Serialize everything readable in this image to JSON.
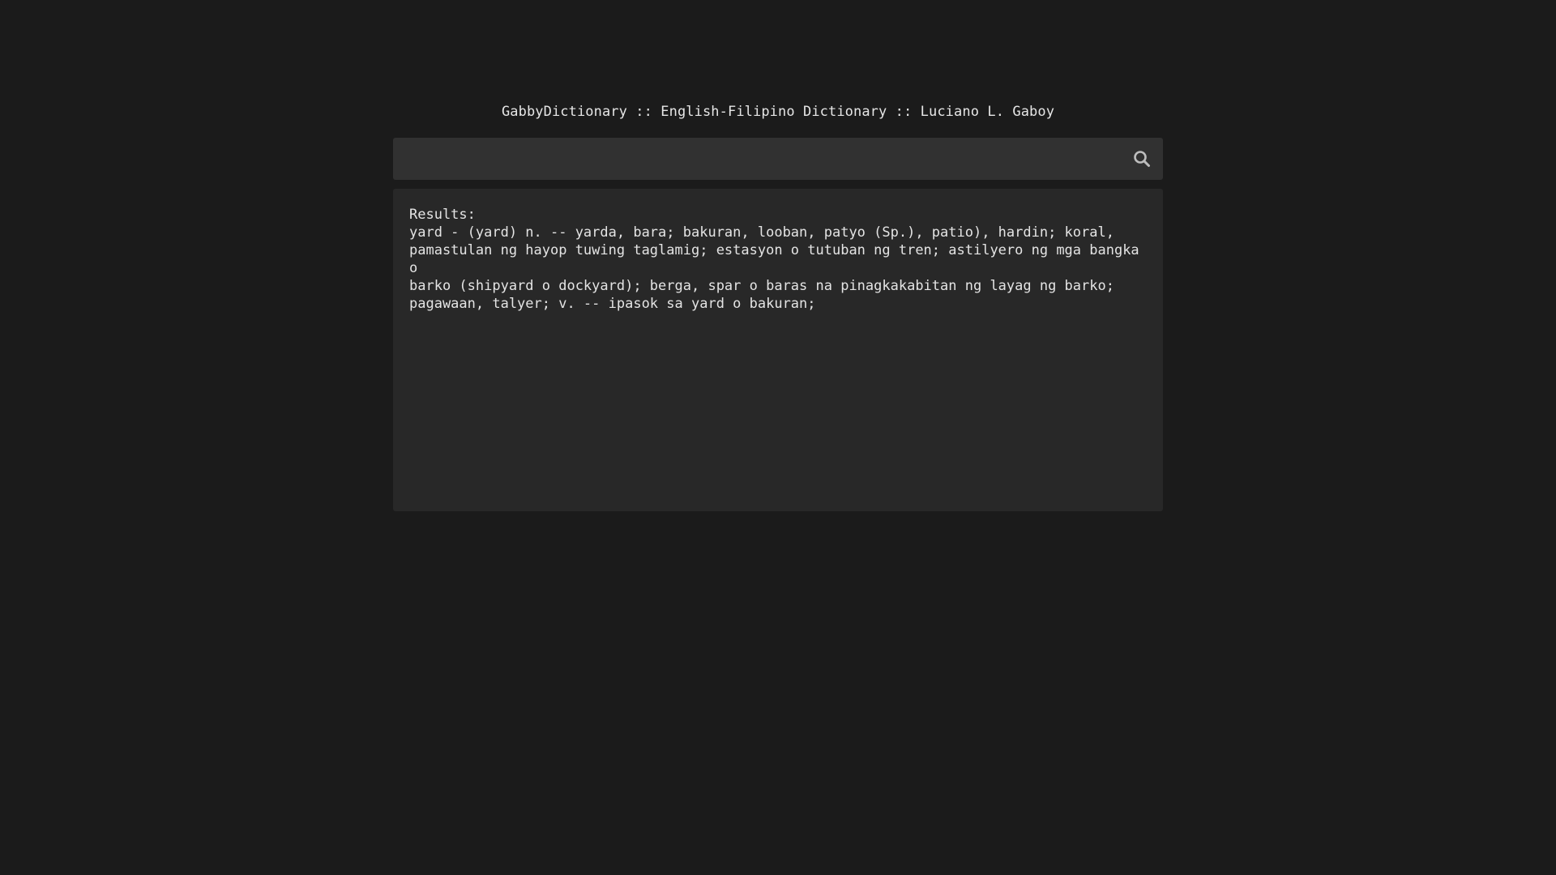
{
  "header": {
    "title": "GabbyDictionary :: English-Filipino Dictionary :: Luciano L. Gaboy"
  },
  "search": {
    "value": "",
    "placeholder": "",
    "icon": "search-icon"
  },
  "results": {
    "heading": "Results:",
    "lines": [
      "yard - (yard) n. -- yarda, bara; bakuran, looban, patyo (Sp.), patio), hardin; koral,",
      "pamastulan ng hayop tuwing taglamig; estasyon o tutuban ng tren; astilyero ng mga bangka o",
      "barko (shipyard o dockyard); berga, spar o baras na pinagkakabitan ng layag ng barko;",
      "pagawaan, talyer; v. -- ipasok sa yard o bakuran;"
    ]
  },
  "colors": {
    "background": "#1b1b1b",
    "search_bar": "#313131",
    "results_panel": "#282828",
    "text": "#e4e4e4",
    "icon": "#bdbdbd"
  }
}
